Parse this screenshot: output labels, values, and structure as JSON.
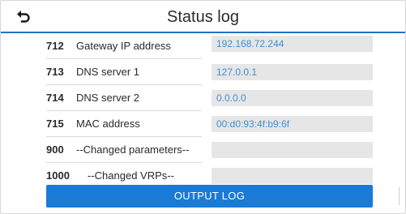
{
  "header": {
    "title": "Status log",
    "back_icon": "undo-arrow-icon"
  },
  "rows": [
    {
      "number": "712",
      "label": "Gateway IP address",
      "value": "192.168.72.244"
    },
    {
      "number": "713",
      "label": "DNS server 1",
      "value": "127.0.0.1"
    },
    {
      "number": "714",
      "label": "DNS server 2",
      "value": "0.0.0.0"
    },
    {
      "number": "715",
      "label": "MAC address",
      "value": "00:d0:93:4f:b9:6f"
    },
    {
      "number": "900",
      "label": "--Changed parameters--",
      "value": ""
    },
    {
      "number": "1000",
      "label": "--Changed VRPs--",
      "value": ""
    }
  ],
  "footer": {
    "output_button_label": "OUTPUT LOG"
  },
  "colors": {
    "accent": "#1a7bd6",
    "value_text": "#3b8fd8",
    "field_bg": "#e6e6e6"
  }
}
